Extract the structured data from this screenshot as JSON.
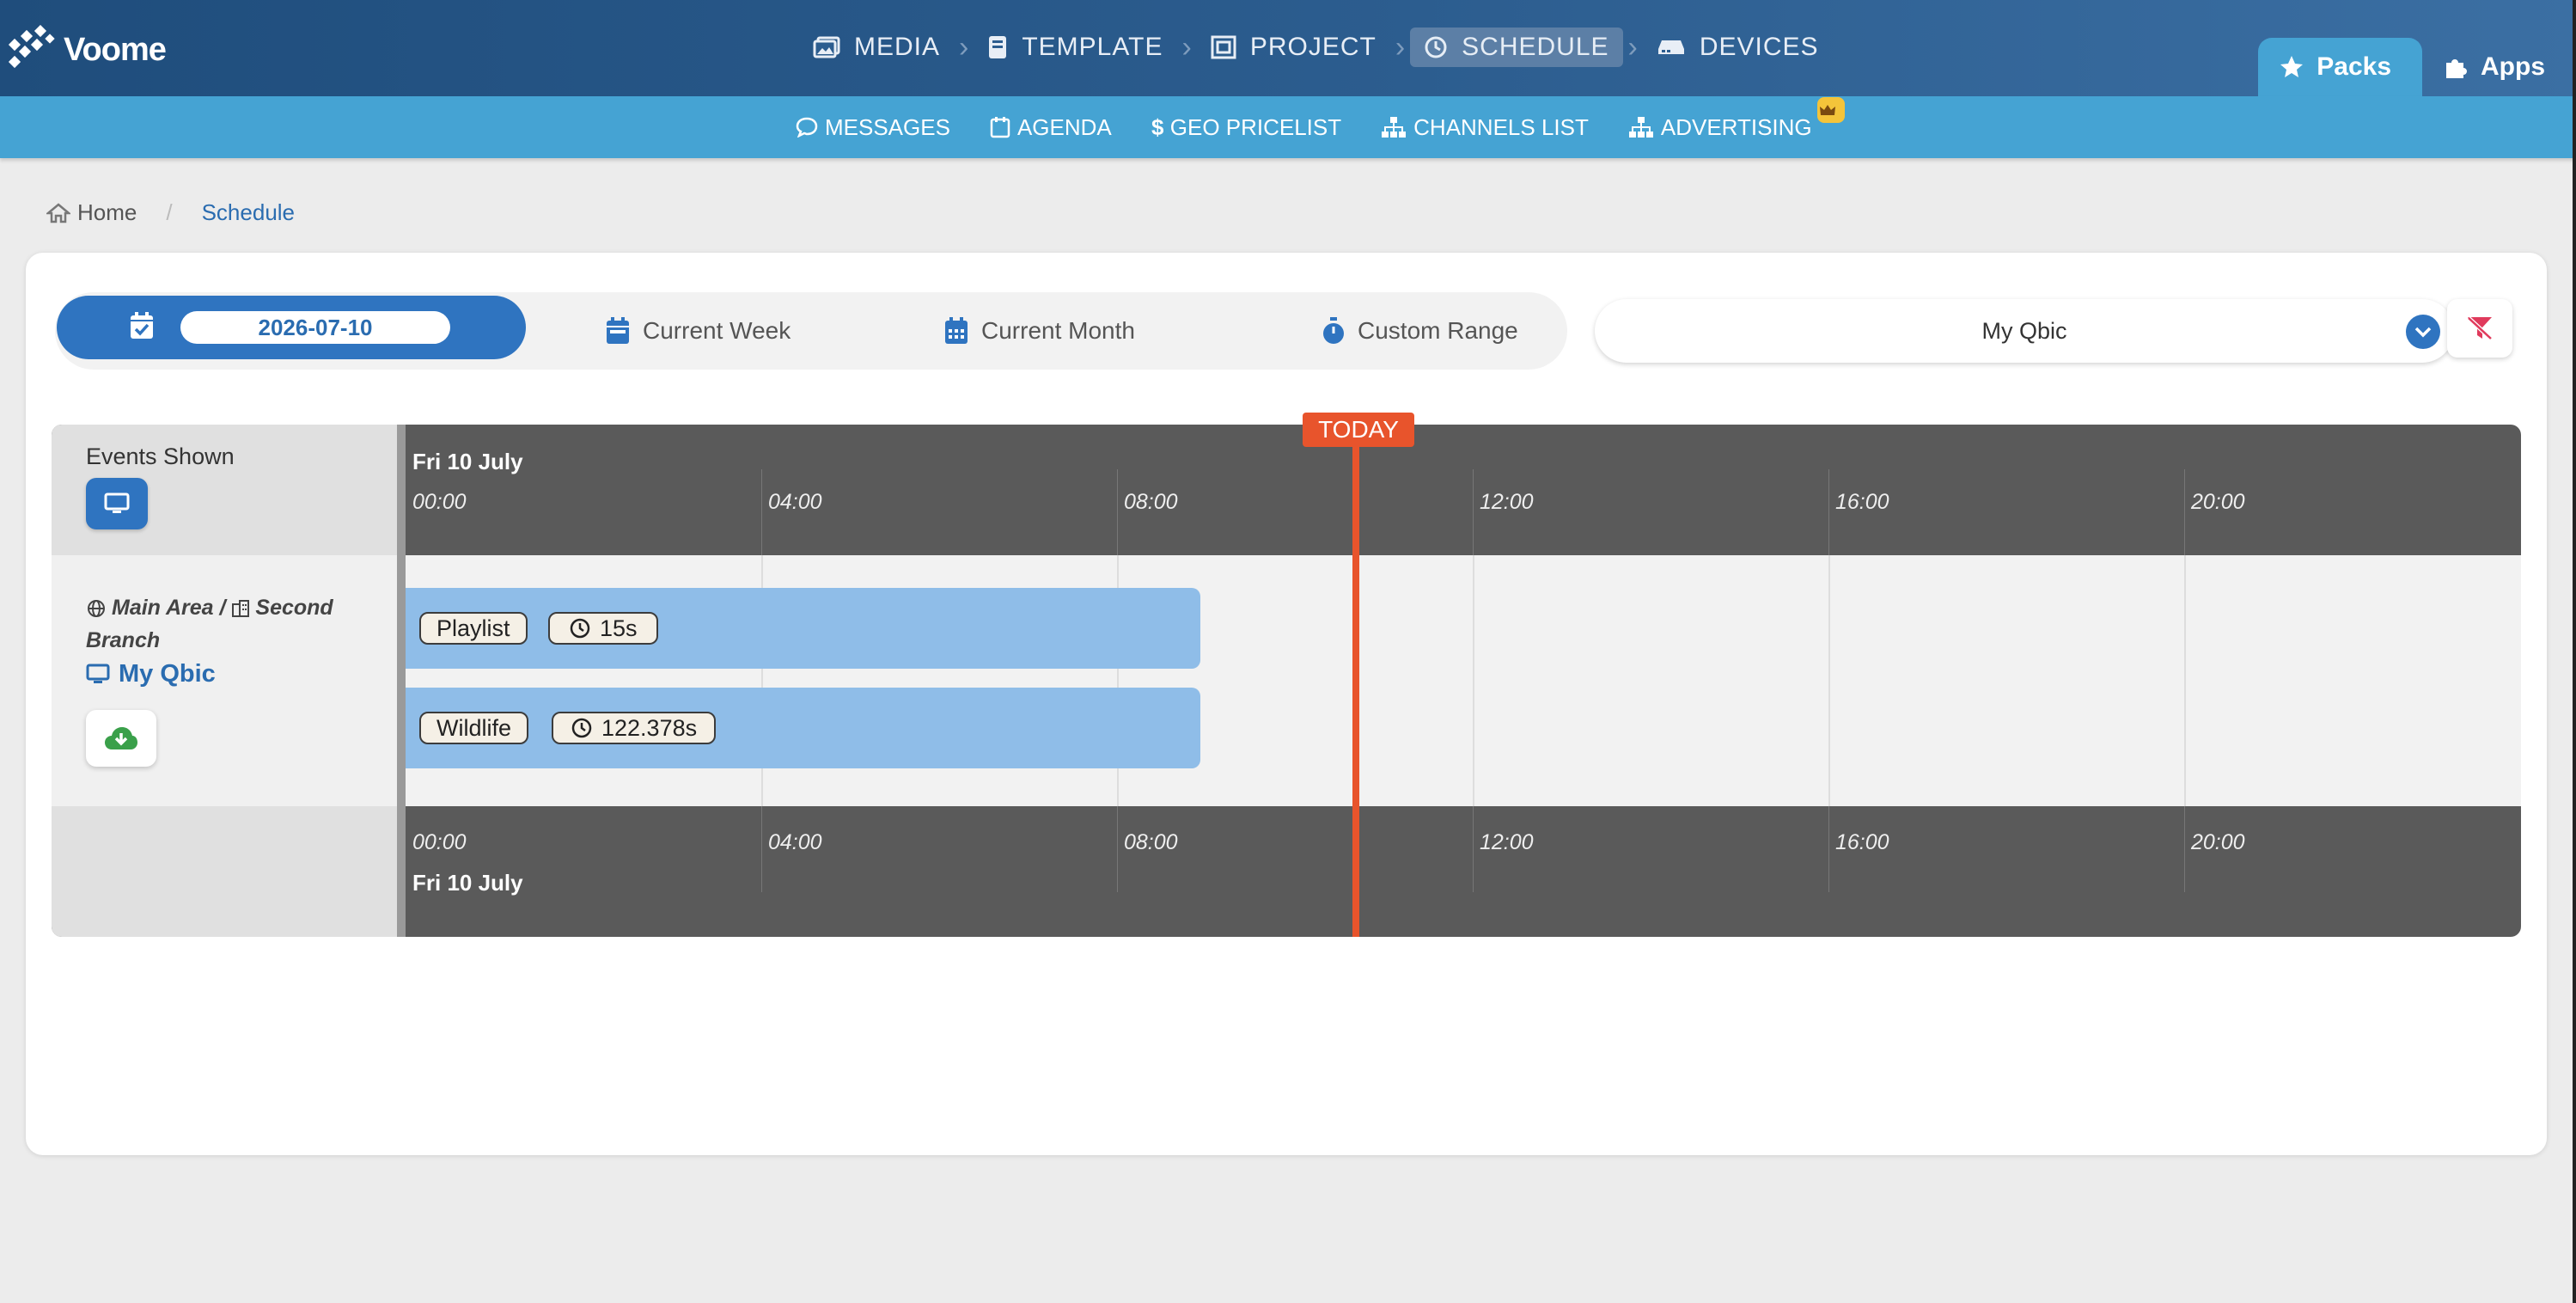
{
  "app": {
    "name": "Voome"
  },
  "nav": {
    "steps": [
      {
        "label": "MEDIA",
        "icon": "image-icon"
      },
      {
        "label": "TEMPLATE",
        "icon": "book-icon"
      },
      {
        "label": "PROJECT",
        "icon": "project-icon"
      },
      {
        "label": "SCHEDULE",
        "icon": "clock-icon",
        "active": true
      },
      {
        "label": "DEVICES",
        "icon": "devices-icon"
      }
    ],
    "packs_label": "Packs",
    "apps_label": "Apps"
  },
  "subnav": {
    "items": [
      {
        "label": "MESSAGES",
        "icon": "chat-icon"
      },
      {
        "label": "AGENDA",
        "icon": "calendar-icon"
      },
      {
        "label": "GEO PRICELIST",
        "icon": "dollar-icon"
      },
      {
        "label": "CHANNELS LIST",
        "icon": "sitemap-icon"
      },
      {
        "label": "ADVERTISING",
        "icon": "sitemap-icon",
        "badge": "crown-icon"
      }
    ]
  },
  "breadcrumb": {
    "home": "Home",
    "current": "Schedule"
  },
  "range": {
    "date": "2026-07-10",
    "week": "Current Week",
    "month": "Current Month",
    "custom": "Custom Range"
  },
  "device_select": {
    "value": "My Qbic"
  },
  "timeline": {
    "events_shown_label": "Events Shown",
    "day_label": "Fri 10 July",
    "ticks": [
      "00:00",
      "04:00",
      "08:00",
      "12:00",
      "16:00",
      "20:00"
    ],
    "today_label": "TODAY",
    "location_area": "Main Area",
    "location_branch": "Second Branch",
    "device_name": "My Qbic",
    "events": [
      {
        "name": "Playlist",
        "duration": "15s"
      },
      {
        "name": "Wildlife",
        "duration": "122.378s"
      }
    ]
  },
  "colors": {
    "primary": "#2f74c0",
    "accent": "#45a3d3",
    "today": "#e8542c",
    "event": "#8fbde8"
  }
}
